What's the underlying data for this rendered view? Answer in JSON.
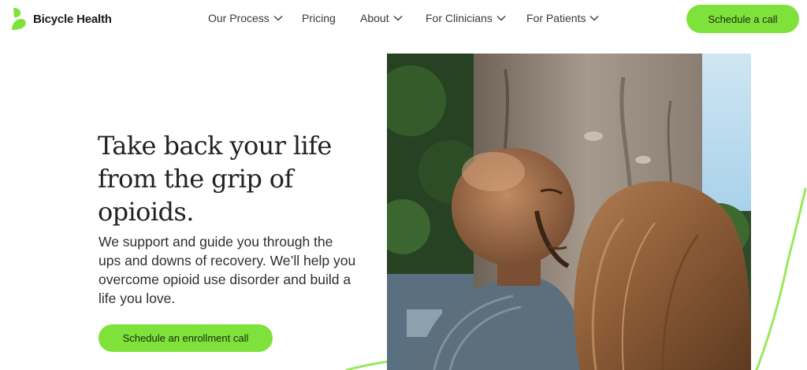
{
  "brand": {
    "name": "Bicycle Health",
    "accent": "#7ee23b"
  },
  "nav": {
    "items": [
      {
        "label": "Our Process",
        "has_dropdown": true
      },
      {
        "label": "Pricing",
        "has_dropdown": false
      },
      {
        "label": "About",
        "has_dropdown": true
      },
      {
        "label": "For Clinicians",
        "has_dropdown": true
      },
      {
        "label": "For Patients",
        "has_dropdown": true
      }
    ],
    "cta_label": "Schedule a call"
  },
  "hero": {
    "title": "Take back your life from the grip of opioids.",
    "subtitle": "We support and guide you through the ups and downs of recovery. We’ll help you overcome opioid use disorder and build a life you love.",
    "cta_label": "Schedule an enrollment call"
  }
}
